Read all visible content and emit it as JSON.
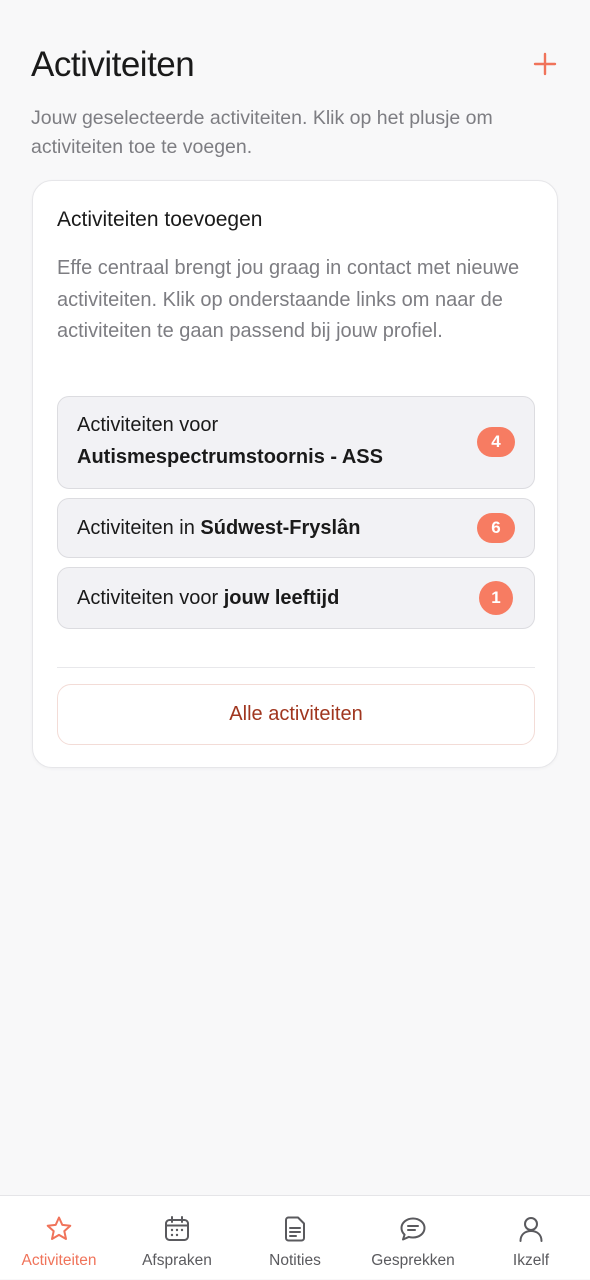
{
  "header": {
    "title": "Activiteiten",
    "add_icon": "plus-icon",
    "accent": "#f0735a"
  },
  "intro": "Jouw geselecteerde activiteiten. Klik op het plusje om activiteiten toe te voegen.",
  "card": {
    "title": "Activiteiten toevoegen",
    "description": "Effe centraal brengt jou graag in contact met nieuwe activiteiten. Klik op onderstaande links om naar de activiteiten te gaan passend bij jouw profiel.",
    "options": [
      {
        "prefix": "Activiteiten voor",
        "bold": "Autismespectrumstoornis - ASS",
        "count": "4"
      },
      {
        "prefix": "Activiteiten in",
        "bold": "Súdwest-Fryslân",
        "count": "6"
      },
      {
        "prefix": "Activiteiten voor",
        "bold": "jouw leeftijd",
        "count": "1"
      }
    ],
    "all_button": "Alle activiteiten"
  },
  "tabbar": {
    "tabs": [
      {
        "label": "Activiteiten",
        "icon": "star-icon",
        "active": true
      },
      {
        "label": "Afspraken",
        "icon": "calendar-icon",
        "active": false
      },
      {
        "label": "Notities",
        "icon": "note-icon",
        "active": false
      },
      {
        "label": "Gesprekken",
        "icon": "chat-icon",
        "active": false
      },
      {
        "label": "Ikzelf",
        "icon": "person-icon",
        "active": false
      }
    ]
  }
}
